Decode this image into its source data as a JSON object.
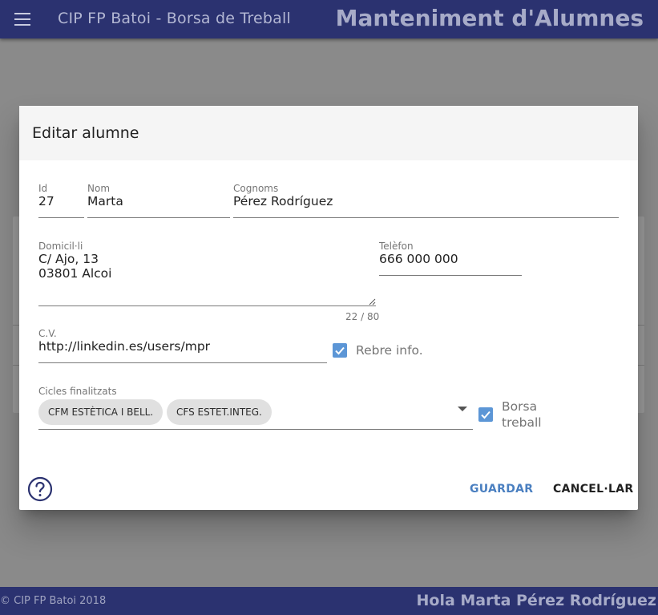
{
  "appbar": {
    "app_title": "CIP FP Batoi - Borsa de Treball",
    "page_title": "Manteniment d'Alumnes",
    "menu_icon": "menu-icon"
  },
  "dialog": {
    "title": "Editar alumne",
    "fields": {
      "id": {
        "label": "Id",
        "value": "27"
      },
      "nom": {
        "label": "Nom",
        "value": "Marta"
      },
      "cognoms": {
        "label": "Cognoms",
        "value": "Pérez Rodríguez"
      },
      "domicili": {
        "label": "Domicil·li",
        "value": "C/ Ajo, 13\n03801 Alcoi",
        "counter": "22 / 80"
      },
      "telefon": {
        "label": "Telèfon",
        "value": "666 000 000"
      },
      "cv": {
        "label": "C.V.",
        "value": "http://linkedin.es/users/mpr"
      },
      "cicles": {
        "label": "Cicles finalitzats",
        "chips": [
          "CFM ESTÈTICA I BELL.",
          "CFS ESTET.INTEG."
        ]
      }
    },
    "checkboxes": {
      "rebre_info": {
        "label": "Rebre info.",
        "checked": true
      },
      "borsa_treball": {
        "label_line1": "Borsa",
        "label_line2": "treball",
        "checked": true
      }
    },
    "buttons": {
      "save": "GUARDAR",
      "cancel": "CANCEL·LAR"
    },
    "help_icon": "help-circle-icon"
  },
  "footer": {
    "copyright": "© CIP FP Batoi 2018",
    "greeting": "Hola Marta Pérez Rodríguez"
  },
  "colors": {
    "appbar": "#2b3270",
    "accent": "#4a7fc0",
    "checkbox": "#5c96d6",
    "help": "#2b3270"
  }
}
